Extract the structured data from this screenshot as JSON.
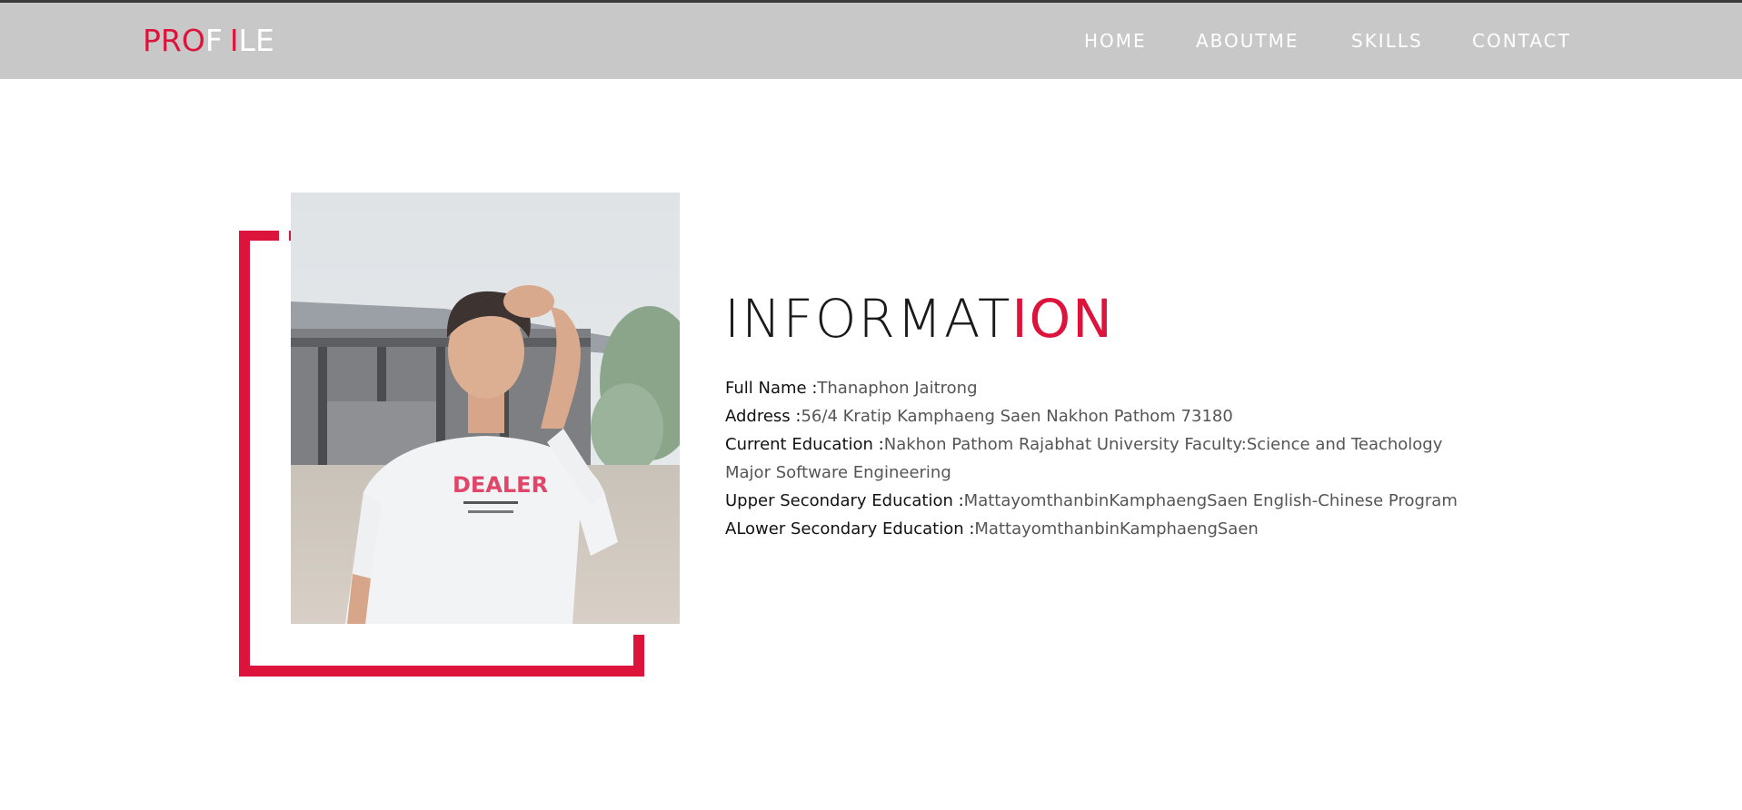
{
  "brand": {
    "letters": [
      {
        "char": "P",
        "color": "#dc143c"
      },
      {
        "char": "R",
        "color": "#dc143c"
      },
      {
        "char": "O",
        "color": "#dc143c"
      },
      {
        "char": "F",
        "color": "#ffffff"
      },
      {
        "char": " ",
        "color": "#ffffff"
      },
      {
        "char": "I",
        "color": "#dc143c"
      },
      {
        "char": "L",
        "color": "#ffffff"
      },
      {
        "char": "E",
        "color": "#ffffff"
      }
    ]
  },
  "nav": {
    "home": "HOME",
    "about": "ABOUTME",
    "skills": "SKILLS",
    "contact": "CONTACT"
  },
  "section": {
    "title_part1": "INFORMAT",
    "title_part2": "ION"
  },
  "info": {
    "full_name_label": "Full Name :",
    "full_name_value": "Thanaphon Jaitrong",
    "address_label": "Address :",
    "address_value": "56/4 Kratip Kamphaeng Saen Nakhon Pathom 73180",
    "current_edu_label": "Current Education :",
    "current_edu_value": "Nakhon Pathom Rajabhat University Faculty:Science and Teachology",
    "current_edu_value_line2": "Major Software Engineering",
    "upper_edu_label": "Upper Secondary Education :",
    "upper_edu_value": "MattayomthanbinKamphaengSaen English-Chinese Program",
    "lower_edu_label": "ALower Secondary Education :",
    "lower_edu_value": "MattayomthanbinKamphaengSaen"
  },
  "colors": {
    "accent": "#dc143c",
    "navbar_bg": "#c8c8c8",
    "nav_text": "#ffffff"
  }
}
